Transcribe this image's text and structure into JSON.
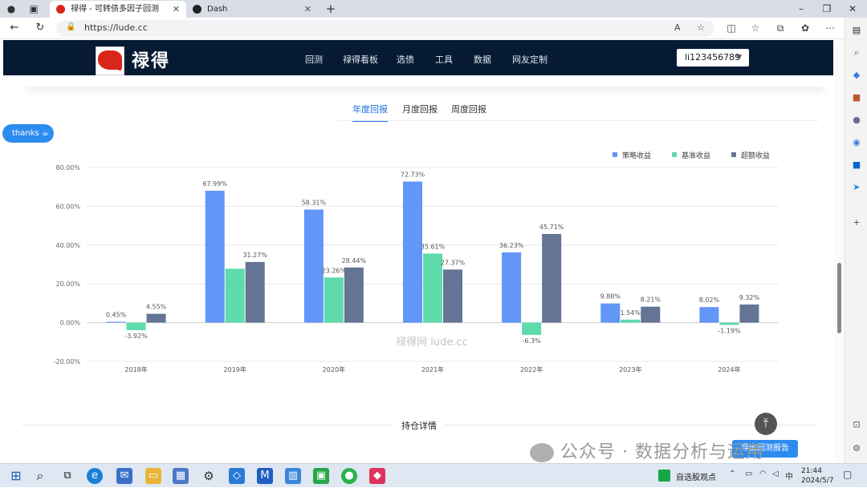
{
  "browser": {
    "tabs": [
      {
        "title": "禄得 - 可转债多因子回测",
        "active": true
      },
      {
        "title": "Dash",
        "active": false
      }
    ],
    "url": "https://lude.cc",
    "new_tab_glyph": "+",
    "close_glyph": "✕"
  },
  "site": {
    "logo_text": "禄得",
    "logo_small": "c",
    "menu": [
      "回测",
      "禄得看板",
      "选债",
      "工具",
      "数据",
      "网友定制"
    ],
    "user": "li123456789",
    "report_tabs": [
      "年度回报",
      "月度回报",
      "周度回报"
    ],
    "thanks_label": "thanks ☕",
    "holdings_title": "持仓详情",
    "report_button": "导出回测报告"
  },
  "chart_data": {
    "type": "bar",
    "categories": [
      "2018年",
      "2019年",
      "2020年",
      "2021年",
      "2022年",
      "2023年",
      "2024年"
    ],
    "series": [
      {
        "name": "策略收益",
        "color": "#6296f7",
        "values": [
          0.45,
          67.99,
          58.31,
          72.73,
          36.23,
          9.88,
          8.02
        ],
        "labels": [
          "0.45%",
          "67.99%",
          "58.31%",
          "72.73%",
          "36.23%",
          "9.88%",
          "8.02%"
        ]
      },
      {
        "name": "基准收益",
        "color": "#5fdbab",
        "values": [
          -3.92,
          27.8,
          23.26,
          35.61,
          -6.3,
          1.54,
          -1.19
        ],
        "labels": [
          "-3.92%",
          "",
          "23.26%",
          "35.61%",
          "-6.3%",
          "1.54%",
          "-1.19%"
        ]
      },
      {
        "name": "超额收益",
        "color": "#637494",
        "values": [
          4.55,
          31.27,
          28.44,
          27.37,
          45.71,
          8.21,
          9.32
        ],
        "labels": [
          "4.55%",
          "31.27%",
          "28.44%",
          "27.37%",
          "45.71%",
          "8.21%",
          "9.32%"
        ]
      }
    ],
    "yticks": [
      "80.00%",
      "60.00%",
      "40.00%",
      "20.00%",
      "0.00%",
      "-20.00%"
    ],
    "ylim": [
      -20,
      80
    ],
    "grid": true,
    "legend": "top-right",
    "watermark": "禄得网 lude.cc"
  },
  "overlay_watermark": "公众号 · 数据分析与运用",
  "taskbar": {
    "news": "自选股观点",
    "ime": "中",
    "time": "21:44",
    "date": "2024/5/7"
  }
}
